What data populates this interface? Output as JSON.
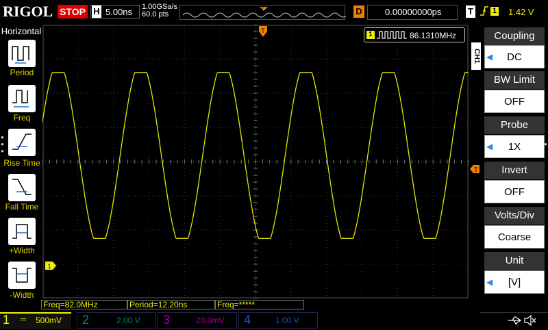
{
  "topbar": {
    "brand": "RIGOL",
    "run_status": "STOP",
    "timebase_letter": "H",
    "timebase": "5.00ns",
    "sample_rate": "1.00GSa/s",
    "memory_depth": "60.0 pts",
    "trigger_marker": "T",
    "delay_letter": "D",
    "delay": "0.00000000ps",
    "trigger_letter": "T",
    "trigger_edge": "rising-edge-icon",
    "trigger_channel": "1",
    "trigger_level": "1.42 V"
  },
  "left_menu": {
    "title": "Horizontal",
    "items": [
      {
        "label": "Period",
        "icon": "period-icon"
      },
      {
        "label": "Freq",
        "icon": "frequency-icon"
      },
      {
        "label": "Rise Time",
        "icon": "rise-time-icon"
      },
      {
        "label": "Fall Time",
        "icon": "fall-time-icon"
      },
      {
        "label": "+Width",
        "icon": "positive-width-icon"
      },
      {
        "label": "-Width",
        "icon": "negative-width-icon"
      }
    ]
  },
  "screen": {
    "counter_channel": "1",
    "counter_value": "86.1310MHz",
    "trigger_position_marker": "T",
    "trigger_level_marker": "T",
    "channel_marker": "1",
    "waveform_color": "#e6e600",
    "grid_color": "#3a3a3a"
  },
  "right_menu": {
    "channel_tab": "CH1",
    "items": [
      {
        "title": "Coupling",
        "value": "DC",
        "arrow": true
      },
      {
        "title": "BW Limit",
        "value": "OFF",
        "arrow": false
      },
      {
        "title": "Probe",
        "value": "1X",
        "arrow": true
      },
      {
        "title": "Invert",
        "value": "OFF",
        "arrow": false
      },
      {
        "title": "Volts/Div",
        "value": "Coarse",
        "arrow": false
      },
      {
        "title": "Unit",
        "value": "[V]",
        "arrow": true
      }
    ]
  },
  "measurements": {
    "freq": "Freq=82.0MHz",
    "period": "Period=12.20ns",
    "freq2": "Freq=*****"
  },
  "channels": [
    {
      "num": "1",
      "scale": "500mV",
      "color": "#f0f000"
    },
    {
      "num": "2",
      "scale": "2.00 V",
      "color": "#00c0c0"
    },
    {
      "num": "3",
      "scale": "20.0mV",
      "color": "#d000d0"
    },
    {
      "num": "4",
      "scale": "1.00 V",
      "color": "#2060ff"
    }
  ],
  "status_icons": [
    "usb-icon",
    "speaker-mute-icon"
  ]
}
